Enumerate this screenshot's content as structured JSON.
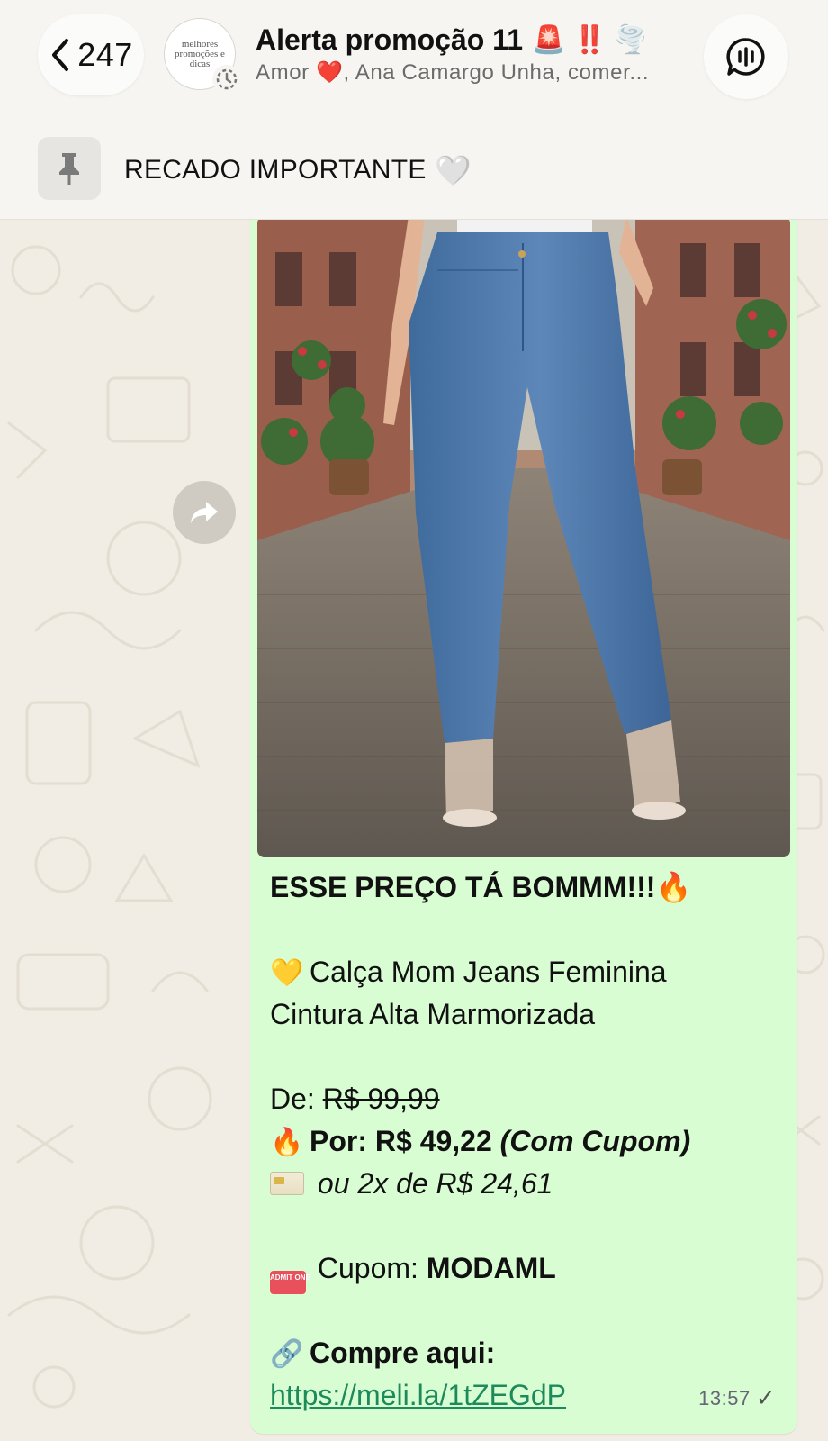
{
  "header": {
    "back_count": "247",
    "avatar_text": "melhores promoções e dicas",
    "title": "Alerta promoção 11",
    "title_emojis": "🚨 ‼️ 🌪️",
    "members_prefix": "Amor",
    "members_heart": "❤️",
    "members_rest": ", Ana Camargo Unha, comer..."
  },
  "pinned": {
    "text": "RECADO IMPORTANTE",
    "emoji": "🤍"
  },
  "message": {
    "headline": "ESSE PREÇO TÁ BOMMM!!!",
    "headline_emoji": "🔥",
    "product_emoji": "💛",
    "product_line1": "Calça Mom Jeans Feminina",
    "product_line2": "Cintura Alta Marmorizada",
    "de_label": "De:",
    "de_price": "R$ 99,99",
    "por_emoji": "🔥",
    "por_label": "Por: R$ 49,22",
    "por_note": "(Com Cupom)",
    "installments": "ou 2x de R$ 24,61",
    "coupon_label": "Cupom:",
    "coupon_code": "MODAML",
    "ticket_text": "ADMIT ONE",
    "link_emoji": "🔗",
    "buy_label": "Compre aqui:",
    "link": "https://meli.la/1tZEGdP",
    "time": "13:57",
    "tick": "✓"
  },
  "colors": {
    "bubble": "#d9fdd3",
    "link": "#1d8a5c",
    "header_bg": "#f6f5f2",
    "wallpaper": "#f1ece4"
  }
}
